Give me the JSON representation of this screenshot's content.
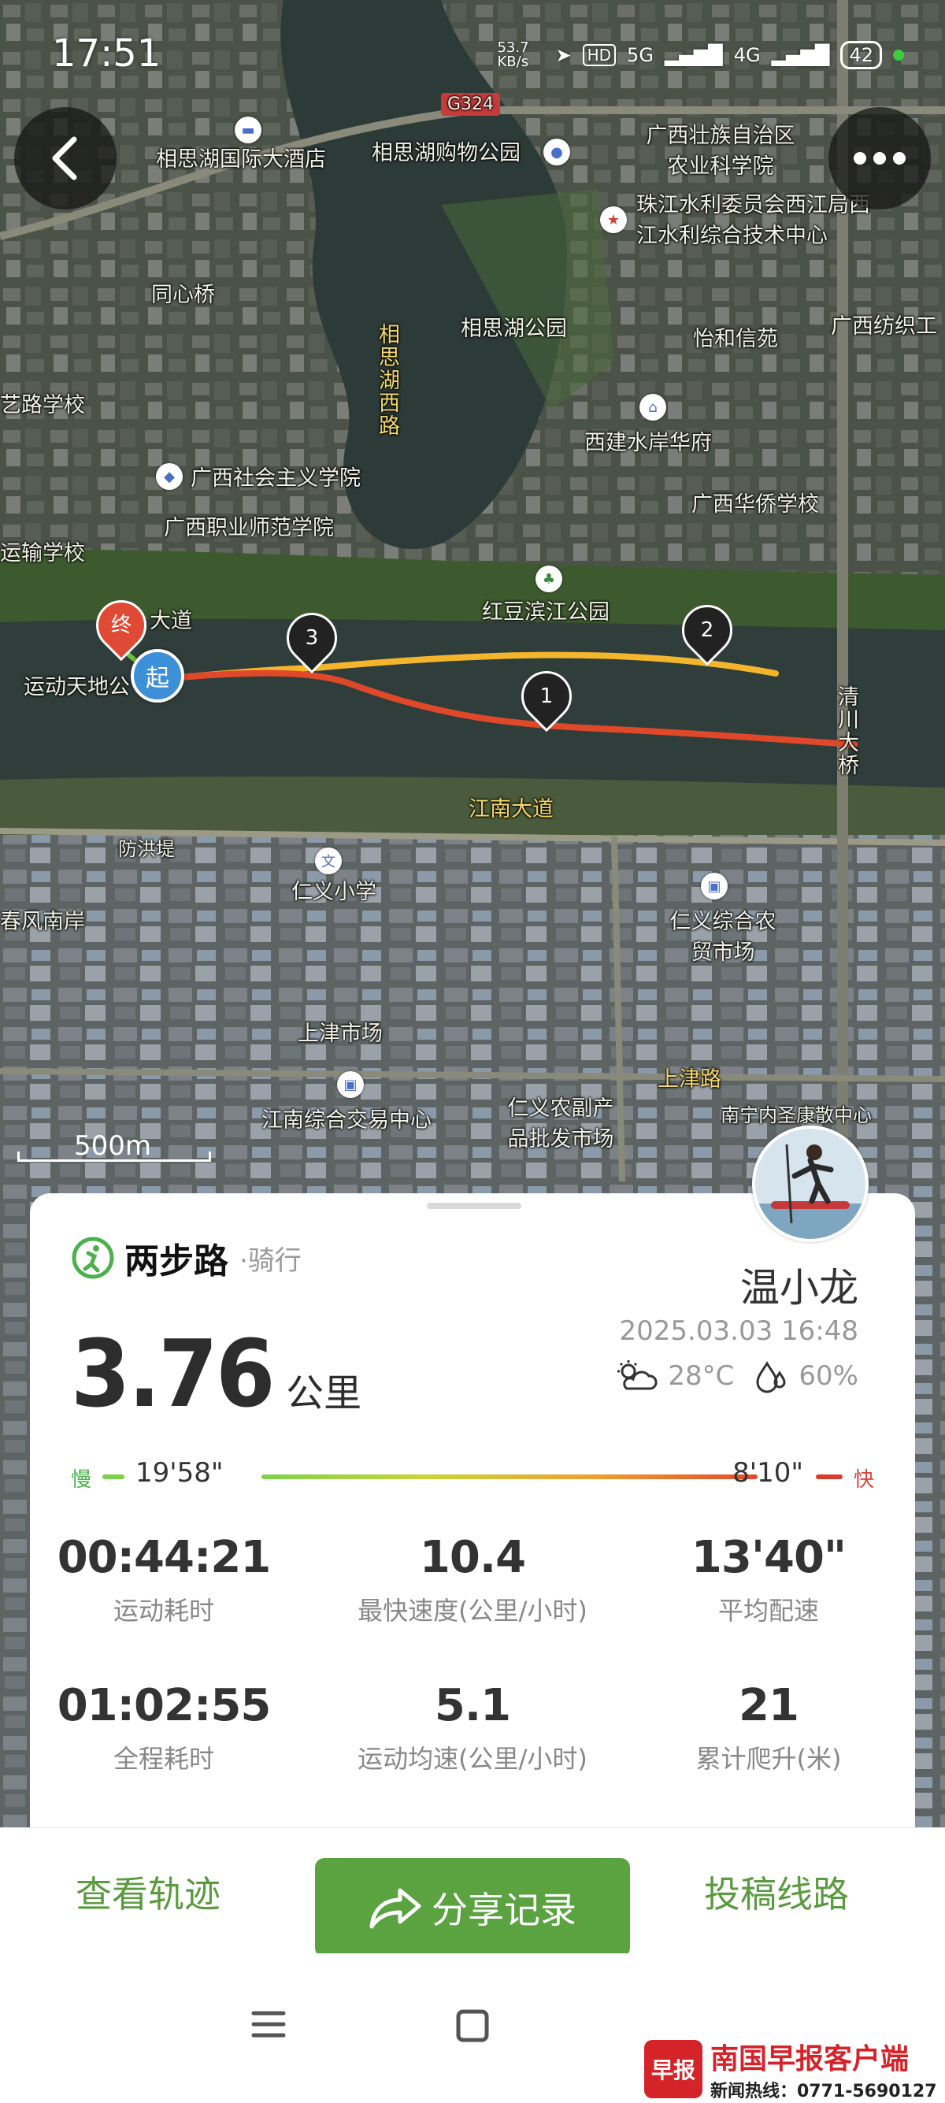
{
  "status_bar": {
    "time": "17:51",
    "net_speed": "53.7 KB/s",
    "hd": "HD",
    "net1": "5G",
    "net2": "4G",
    "battery": "42"
  },
  "map": {
    "scale_label": "500m",
    "labels": [
      {
        "text": "相思湖国际大酒店",
        "style": "white"
      },
      {
        "text": "相思湖购物公园",
        "style": "white"
      },
      {
        "text": "G324",
        "style": "road"
      },
      {
        "text": "广西壮族自治区农业科学院",
        "style": "white"
      },
      {
        "text": "珠江水利委员会西江局西江水利综合技术中心",
        "style": "white"
      },
      {
        "text": "同心桥",
        "style": "white"
      },
      {
        "text": "相思湖公园",
        "style": "white"
      },
      {
        "text": "怡和信苑",
        "style": "white"
      },
      {
        "text": "广西纺织工",
        "style": "white"
      },
      {
        "text": "相思湖西路",
        "style": "yellow"
      },
      {
        "text": "西建水岸华府",
        "style": "white"
      },
      {
        "text": "广西社会主义学院",
        "style": "white"
      },
      {
        "text": "广西职业师范学院",
        "style": "white"
      },
      {
        "text": "广西华侨学校",
        "style": "white"
      },
      {
        "text": "红豆滨江公园",
        "style": "white"
      },
      {
        "text": "大道",
        "style": "white"
      },
      {
        "text": "运动天地公",
        "style": "white"
      },
      {
        "text": "清川大桥",
        "style": "white"
      },
      {
        "text": "江南大道",
        "style": "yellow"
      },
      {
        "text": "防洪堤",
        "style": "white"
      },
      {
        "text": "仁义小学",
        "style": "white"
      },
      {
        "text": "仁义综合农贸市场",
        "style": "white"
      },
      {
        "text": "上津市场",
        "style": "white"
      },
      {
        "text": "上津路",
        "style": "yellow"
      },
      {
        "text": "江南综合交易中心",
        "style": "white"
      },
      {
        "text": "仁义农副产品批发市场",
        "style": "white"
      },
      {
        "text": "南宁内圣康散中心",
        "style": "white"
      },
      {
        "text": "春风南岸",
        "style": "white"
      },
      {
        "text": "运输学校",
        "style": "white"
      },
      {
        "text": "艺路学校",
        "style": "white"
      }
    ],
    "markers": {
      "start": "起",
      "end": "终",
      "km1": "1",
      "km2": "2",
      "km3": "3"
    },
    "icons": [
      "hotel-icon",
      "shop-icon",
      "gov-icon",
      "school-icon",
      "home-icon",
      "park-icon",
      "market-icon"
    ]
  },
  "header": {
    "back_icon": "chevron-left-icon",
    "more_icon": "more-dots-icon"
  },
  "card": {
    "brand": "两步路",
    "activity_type": "·骑行",
    "user_name": "温小龙",
    "datetime": "2025.03.03 16:48",
    "temperature": "28°C",
    "humidity": "60%",
    "distance_value": "3.76",
    "distance_unit": "公里",
    "pace_bar": {
      "slow_label": "慢",
      "fast_label": "快",
      "slowest_pace": "19'58\"",
      "fastest_pace": "8'10\""
    },
    "stats": [
      {
        "value": "00:44:21",
        "label": "运动耗时"
      },
      {
        "value": "10.4",
        "label": "最快速度(公里/小时)"
      },
      {
        "value": "13'40\"",
        "label": "平均配速"
      },
      {
        "value": "01:02:55",
        "label": "全程耗时"
      },
      {
        "value": "5.1",
        "label": "运动均速(公里/小时)"
      },
      {
        "value": "21",
        "label": "累计爬升(米)"
      }
    ]
  },
  "actions": {
    "view_track": "查看轨迹",
    "share": "分享记录",
    "submit_route": "投稿线路"
  },
  "watermark": {
    "logo_text": "早报",
    "title": "南国早报客户端",
    "hotline": "新闻热线：0771-5690127"
  },
  "colors": {
    "accent_green": "#5aa340",
    "route_red": "#e0482a",
    "route_yellow": "#f3b52b",
    "river": "#2f3d3b"
  }
}
